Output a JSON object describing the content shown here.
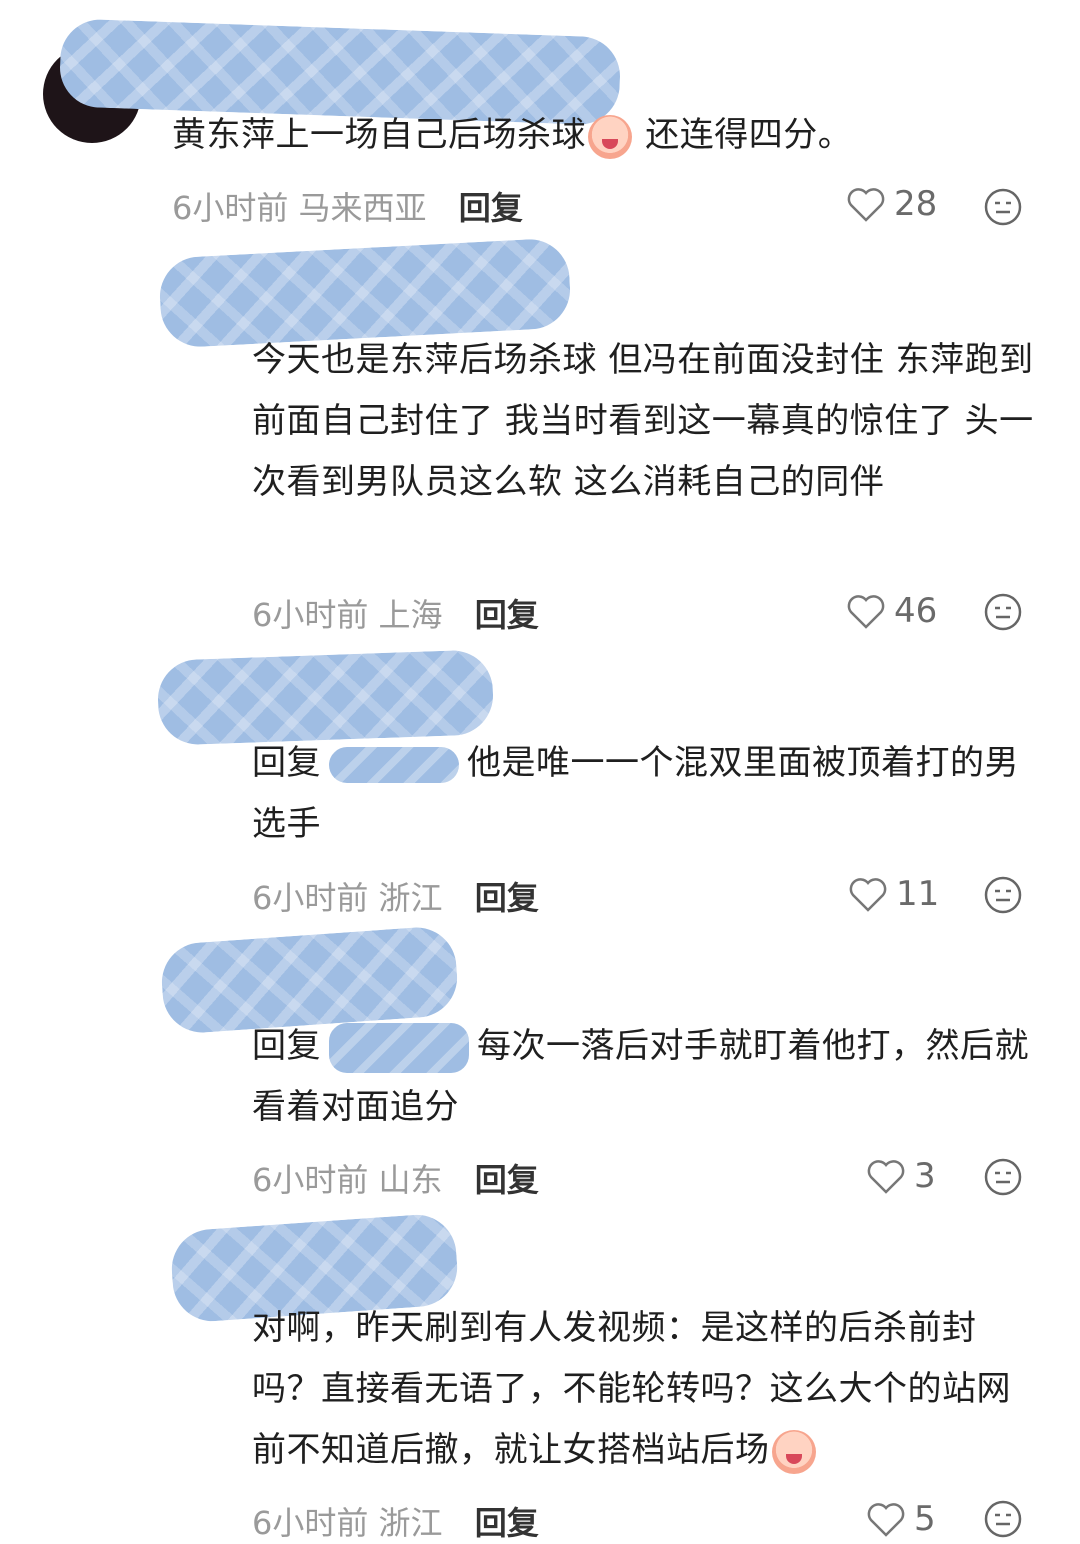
{
  "comments": [
    {
      "text_a": "黄东萍上一场自己后场杀球",
      "text_b": " 还连得四分。",
      "time": "6小时前",
      "location": "马来西亚",
      "reply": "回复",
      "likes": "28"
    },
    {
      "text": "今天也是东萍后场杀球 但冯在前面没封住 东萍跑到前面自己封住了 我当时看到这一幕真的惊住了 头一次看到男队员这么软 这么消耗自己的同伴",
      "time": "6小时前",
      "location": "上海",
      "reply": "回复",
      "likes": "46"
    },
    {
      "prefix": "回复",
      "text": "他是唯一一个混双里面被顶着打的男选手",
      "time": "6小时前",
      "location": "浙江",
      "reply": "回复",
      "likes": "11"
    },
    {
      "prefix": "回复",
      "text": "每次一落后对手就盯着他打，然后就看着对面追分",
      "time": "6小时前",
      "location": "山东",
      "reply": "回复",
      "likes": "3"
    },
    {
      "text": "对啊，昨天刷到有人发视频：是这样的后杀前封吗？直接看无语了，不能轮转吗？这么大个的站网前不知道后撤，就让女搭档站后场",
      "time": "6小时前",
      "location": "浙江",
      "reply": "回复",
      "likes": "5"
    }
  ],
  "icons": {
    "like": "heart-outline-icon",
    "reaction": "emoji-face-icon"
  },
  "colors": {
    "blur": "#9fbde3",
    "meta": "#9a9a9a",
    "text": "#1f1f1f"
  }
}
